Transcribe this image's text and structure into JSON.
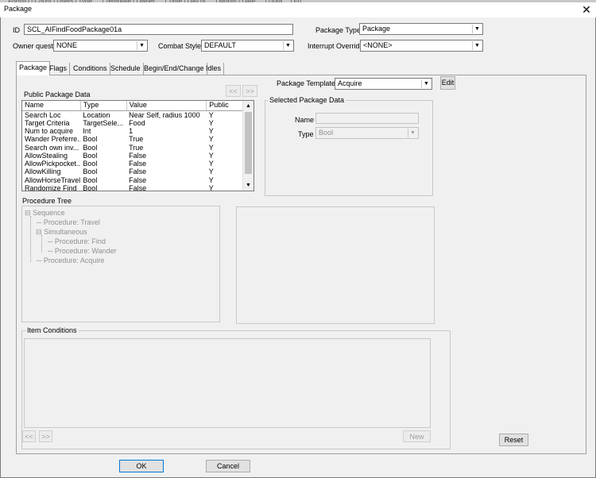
{
  "background_strip": "… FormID  |  Count  |  Users  |  Type  …  |  Template  |  Owner  …  |  Time  |  Day of …  |  Month  |  Date  …  |  Dura…  |  Fu…",
  "window": {
    "title": "Package",
    "close_glyph": "✕"
  },
  "header": {
    "id_label": "ID",
    "id_value": "SCL_AIFindFoodPackage01a",
    "package_type_label": "Package Type",
    "package_type_value": "Package",
    "owner_quest_label": "Owner quest",
    "owner_quest_value": "NONE",
    "combat_style_label": "Combat Style",
    "combat_style_value": "DEFAULT",
    "interrupt_override_label": "Interrupt Override",
    "interrupt_override_value": "<NONE>"
  },
  "tabs": [
    {
      "label": "Package"
    },
    {
      "label": "Flags"
    },
    {
      "label": "Conditions"
    },
    {
      "label": "Schedule"
    },
    {
      "label": "Begin/End/Change"
    },
    {
      "label": "Idles"
    }
  ],
  "public_data": {
    "title": "Public Package Data",
    "prev_label": "<<",
    "next_label": ">>",
    "columns": [
      "Name",
      "Type",
      "Value",
      "Public"
    ],
    "rows": [
      [
        "Search Loc",
        "Location",
        "Near Self, radius 1000",
        "Y"
      ],
      [
        "Target Criteria",
        "TargetSele...",
        "Food",
        "Y"
      ],
      [
        "Num to acquire",
        "Int",
        "1",
        "Y"
      ],
      [
        "Wander Preferre...",
        "Bool",
        "True",
        "Y"
      ],
      [
        "Search own inv...",
        "Bool",
        "True",
        "Y"
      ],
      [
        "AllowStealing",
        "Bool",
        "False",
        "Y"
      ],
      [
        "AllowPickpocket...",
        "Bool",
        "False",
        "Y"
      ],
      [
        "AllowKilling",
        "Bool",
        "False",
        "Y"
      ],
      [
        "AllowHorseTravel",
        "Bool",
        "False",
        "Y"
      ],
      [
        "Randomize Find",
        "Bool",
        "False",
        "Y"
      ]
    ]
  },
  "template": {
    "label": "Package Template",
    "value": "Acquire",
    "edit_label": "Edit"
  },
  "selected_data": {
    "title": "Selected Package Data",
    "name_label": "Name",
    "name_value": "",
    "type_label": "Type",
    "type_value": "Bool"
  },
  "procedure_tree": {
    "title": "Procedure Tree",
    "nodes": [
      {
        "label": "Sequence",
        "box": "⊟"
      },
      {
        "label": "Procedure: Travel"
      },
      {
        "label": "Simultaneous",
        "box": "⊟"
      },
      {
        "label": "Procedure: Find"
      },
      {
        "label": "Procedure: Wander"
      },
      {
        "label": "Procedure: Acquire"
      }
    ]
  },
  "item_conditions": {
    "title": "Item Conditions",
    "prev_label": "<<",
    "next_label": ">>",
    "new_label": "New"
  },
  "footer": {
    "reset_label": "Reset",
    "ok_label": "OK",
    "cancel_label": "Cancel"
  },
  "icons": {
    "dropdown": "chevron-down-icon",
    "scroll_up": "chevron-up-icon",
    "scroll_down": "chevron-down-icon",
    "tree_minus": "minus-box-icon",
    "close": "close-icon"
  },
  "colors": {
    "window_bg": "#f0f0f0",
    "field_bg": "#ffffff",
    "border": "#7a7a7a",
    "disabled_text": "#8f8f8f"
  }
}
